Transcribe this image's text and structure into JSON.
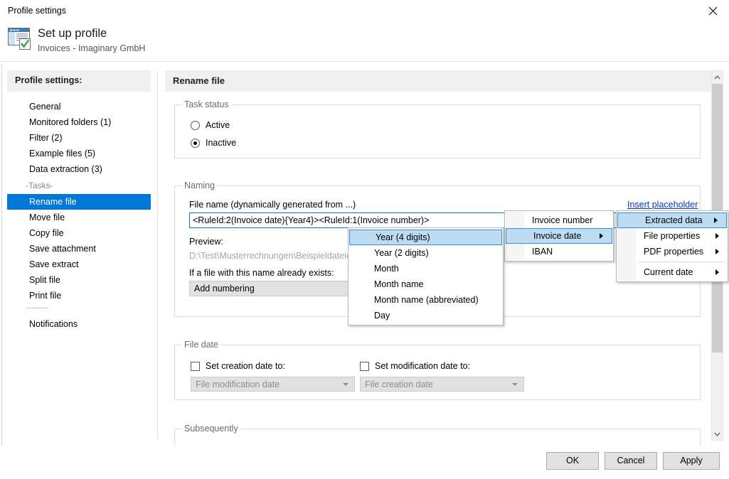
{
  "window": {
    "title": "Profile settings",
    "close_icon": "close-icon"
  },
  "header": {
    "title": "Set up profile",
    "subtitle": "Invoices - Imaginary GmbH",
    "icon": "profile-window-check-icon"
  },
  "sidebar": {
    "heading": "Profile settings:",
    "items": [
      {
        "label": "General",
        "selected": false
      },
      {
        "label": "Monitored folders (1)",
        "selected": false
      },
      {
        "label": "Filter (2)",
        "selected": false
      },
      {
        "label": "Example files (5)",
        "selected": false
      },
      {
        "label": "Data extraction (3)",
        "selected": false
      }
    ],
    "group_label": "-Tasks-",
    "tasks": [
      {
        "label": "Rename file",
        "selected": true
      },
      {
        "label": "Move file",
        "selected": false
      },
      {
        "label": "Copy file",
        "selected": false
      },
      {
        "label": "Save attachment",
        "selected": false
      },
      {
        "label": "Save extract",
        "selected": false
      },
      {
        "label": "Split file",
        "selected": false
      },
      {
        "label": "Print file",
        "selected": false
      }
    ],
    "footer_items": [
      {
        "label": "Notifications",
        "selected": false
      }
    ]
  },
  "main": {
    "heading": "Rename file",
    "task_status": {
      "legend": "Task status",
      "options": [
        {
          "label": "Active",
          "checked": false
        },
        {
          "label": "Inactive",
          "checked": true
        }
      ]
    },
    "naming": {
      "legend": "Naming",
      "filename_label": "File name (dynamically generated from ...)",
      "filename_value": "<RuleId:2(Invoice date){Year4}><RuleId:1(Invoice number)>",
      "insert_placeholder_link": "Insert placeholder",
      "preview_label": "Preview:",
      "preview_value": "D:\\Test\\Musterrechnungen\\Beispieldateien",
      "exists_label": "If a file with this name already exists:",
      "exists_value": "Add numbering"
    },
    "file_date": {
      "legend": "File date",
      "creation": {
        "checkbox_label": "Set creation date to:",
        "checked": false,
        "combo_value": "File modification date"
      },
      "modification": {
        "checkbox_label": "Set modification date to:",
        "checked": false,
        "combo_value": "File creation date"
      }
    },
    "subsequently": {
      "legend": "Subsequently"
    }
  },
  "menus": {
    "placeholder_categories": {
      "items": [
        {
          "label": "Extracted data",
          "submenu": true,
          "highlight": true
        },
        {
          "label": "File properties",
          "submenu": true,
          "highlight": false
        },
        {
          "label": "PDF properties",
          "submenu": true,
          "highlight": false
        },
        {
          "separator": true
        },
        {
          "label": "Current date",
          "submenu": true,
          "highlight": false
        }
      ]
    },
    "extracted_data": {
      "items": [
        {
          "label": "Invoice number",
          "submenu": false,
          "highlight": false
        },
        {
          "label": "Invoice date",
          "submenu": true,
          "highlight": true
        },
        {
          "label": "IBAN",
          "submenu": false,
          "highlight": false
        }
      ]
    },
    "date_parts": {
      "items": [
        {
          "label": "Year (4 digits)",
          "highlight": true
        },
        {
          "label": "Year (2 digits)",
          "highlight": false
        },
        {
          "label": "Month",
          "highlight": false
        },
        {
          "label": "Month name",
          "highlight": false
        },
        {
          "label": "Month name (abbreviated)",
          "highlight": false
        },
        {
          "label": "Day",
          "highlight": false
        }
      ]
    }
  },
  "scrollbar": {
    "up_icon": "chevron-up-icon",
    "down_icon": "chevron-down-icon"
  },
  "footer": {
    "ok": "OK",
    "cancel": "Cancel",
    "apply": "Apply"
  },
  "colors": {
    "accent": "#0078d7",
    "menu_highlight": "#bcdcf4",
    "link": "#0a34c4"
  }
}
